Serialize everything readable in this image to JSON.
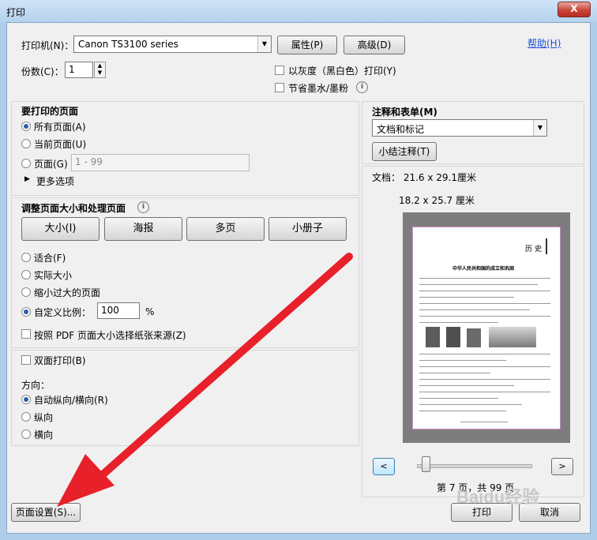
{
  "window": {
    "title": "打印",
    "close": "X"
  },
  "printer": {
    "label": "打印机(N)：",
    "value": "Canon TS3100 series",
    "properties": "属性(P)",
    "advanced": "高级(D)",
    "help": "帮助(H)"
  },
  "copies": {
    "label": "份数(C)：",
    "value": "1"
  },
  "options": {
    "grayscale": "以灰度（黑白色）打印(Y)",
    "save_ink": "节省墨水/墨粉"
  },
  "pages": {
    "header": "要打印的页面",
    "all": "所有页面(A)",
    "current": "当前页面(U)",
    "range": "页面(G)",
    "range_value": "1 - 99",
    "more": "更多选项"
  },
  "sizing": {
    "header": "调整页面大小和处理页面",
    "buttons": [
      "大小(I)",
      "海报",
      "多页",
      "小册子"
    ],
    "fit": "适合(F)",
    "actual": "实际大小",
    "shrink": "缩小过大的页面",
    "custom": "自定义比例：",
    "scale_value": "100",
    "percent": "%",
    "pdf_source": "按照 PDF 页面大小选择纸张来源(Z)"
  },
  "duplex": {
    "label": "双面打印(B)"
  },
  "orientation": {
    "header": "方向：",
    "auto": "自动纵向/横向(R)",
    "portrait": "纵向",
    "landscape": "横向"
  },
  "comments": {
    "header": "注释和表单(M)",
    "value": "文档和标记",
    "summarize": "小结注释(T)"
  },
  "preview": {
    "doc_size": "文档： 21.6 x 29.1厘米",
    "paper_size": "18.2 x 25.7 厘米",
    "page_status": "第 7 页，共 99 页",
    "doc_subject": "历 史",
    "doc_title": "中华人民共和国的成立和巩固"
  },
  "nav": {
    "prev": "<",
    "next": ">"
  },
  "footer": {
    "page_setup": "页面设置(S)...",
    "print": "打印",
    "cancel": "取消"
  },
  "watermark": "Baidu经验",
  "colors": {
    "accent": "#2b5ea8",
    "arrow": "#e8202a"
  }
}
